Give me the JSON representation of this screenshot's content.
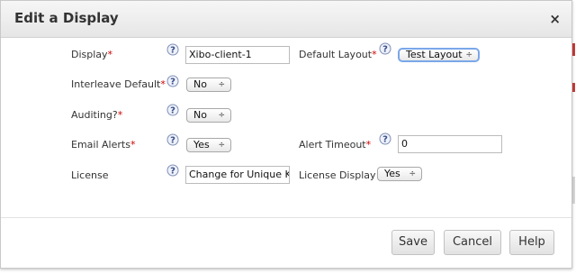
{
  "dialog": {
    "title": "Edit a Display",
    "close_glyph": "×"
  },
  "fields": {
    "display": {
      "label": "Display",
      "value": "Xibo-client-1"
    },
    "default_layout": {
      "label": "Default Layout",
      "value": "Test Layout"
    },
    "interleave_default": {
      "label": "Interleave Default",
      "value": "No"
    },
    "auditing": {
      "label": "Auditing?",
      "value": "No"
    },
    "email_alerts": {
      "label": "Email Alerts",
      "value": "Yes"
    },
    "alert_timeout": {
      "label": "Alert Timeout",
      "value": "0"
    },
    "license": {
      "label": "License",
      "value": "Change for Unique Key"
    },
    "license_display": {
      "label": "License Display",
      "value": "Yes"
    }
  },
  "required_marker": "*",
  "help_icon": "question-help-icon",
  "select_arrow": "÷",
  "buttons": {
    "save": "Save",
    "cancel": "Cancel",
    "help": "Help"
  },
  "colors": {
    "required": "#cc0000",
    "focus_ring": "#7aa7e9"
  }
}
